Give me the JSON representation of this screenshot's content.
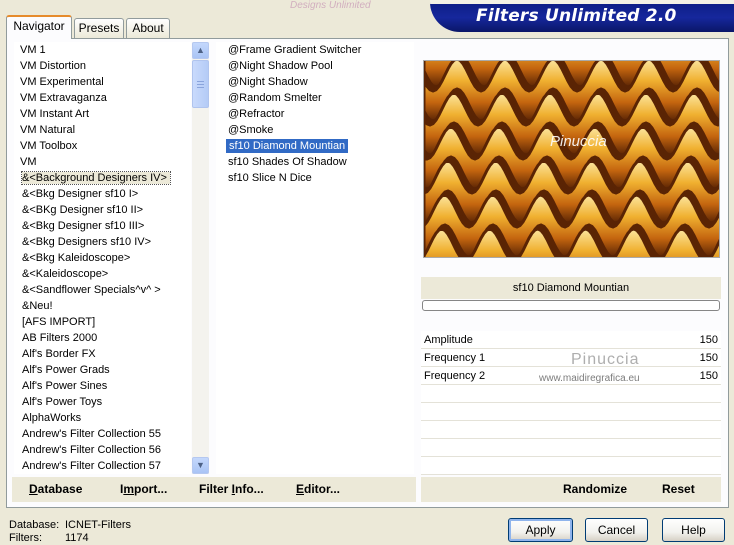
{
  "header": {
    "title": "Filters Unlimited 2.0",
    "background_scribble": "Designs Unlimited"
  },
  "tabs": [
    {
      "label": "Navigator",
      "active": true
    },
    {
      "label": "Presets",
      "active": false
    },
    {
      "label": "About",
      "active": false
    }
  ],
  "categories": [
    "VM 1",
    "VM Distortion",
    "VM Experimental",
    "VM Extravaganza",
    "VM Instant Art",
    "VM Natural",
    "VM Toolbox",
    "VM",
    "&<Background Designers IV>",
    "&<Bkg Designer sf10 I>",
    "&<BKg Designer sf10 II>",
    "&<Bkg Designer sf10 III>",
    "&<Bkg Designers sf10 IV>",
    "&<Bkg Kaleidoscope>",
    "&<Kaleidoscope>",
    "&<Sandflower Specials^v^ >",
    "&Neu!",
    "[AFS IMPORT]",
    "AB Filters 2000",
    "Alf's Border FX",
    "Alf's Power Grads",
    "Alf's Power Sines",
    "Alf's Power Toys",
    "AlphaWorks",
    "Andrew's Filter Collection 55",
    "Andrew's Filter Collection 56",
    "Andrew's Filter Collection 57"
  ],
  "selected_category_index": 8,
  "filters": [
    "@Frame Gradient Switcher",
    "@Night Shadow Pool",
    "@Night Shadow",
    "@Random Smelter",
    "@Refractor",
    "@Smoke",
    "sf10 Diamond Mountian",
    "sf10 Shades Of Shadow",
    "sf10 Slice N Dice"
  ],
  "selected_filter_index": 6,
  "preview": {
    "watermark": "Pinuccia",
    "colors": {
      "dark": "#5a2404",
      "mid": "#c4650f",
      "light": "#f0b030",
      "pale": "#fce6a0"
    }
  },
  "selected_filter_name": "sf10 Diamond Mountian",
  "params": [
    {
      "label": "Amplitude",
      "value": "150"
    },
    {
      "label": "Frequency 1",
      "value": "150"
    },
    {
      "label": "Frequency 2",
      "value": "150"
    },
    {
      "label": "",
      "value": ""
    },
    {
      "label": "",
      "value": ""
    },
    {
      "label": "",
      "value": ""
    },
    {
      "label": "",
      "value": ""
    },
    {
      "label": "",
      "value": ""
    }
  ],
  "watermark": {
    "author": "Pinuccia",
    "site": "www.maidiregrafica.eu"
  },
  "left_buttons": {
    "database": {
      "u": "D",
      "rest": "atabase"
    },
    "import": {
      "pre": "I",
      "u": "m",
      "rest": "port..."
    },
    "filter_info": {
      "pre": "Filter ",
      "u": "I",
      "rest": "nfo..."
    },
    "editor": {
      "u": "E",
      "rest": "ditor..."
    }
  },
  "right_buttons": {
    "randomize": "Randomize",
    "reset": "Reset"
  },
  "status": {
    "database_label": "Database:",
    "database_value": "ICNET-Filters",
    "filters_label": "Filters:",
    "filters_value": "1174"
  },
  "dialog_buttons": {
    "apply": "Apply",
    "cancel": "Cancel",
    "help": "Help"
  }
}
